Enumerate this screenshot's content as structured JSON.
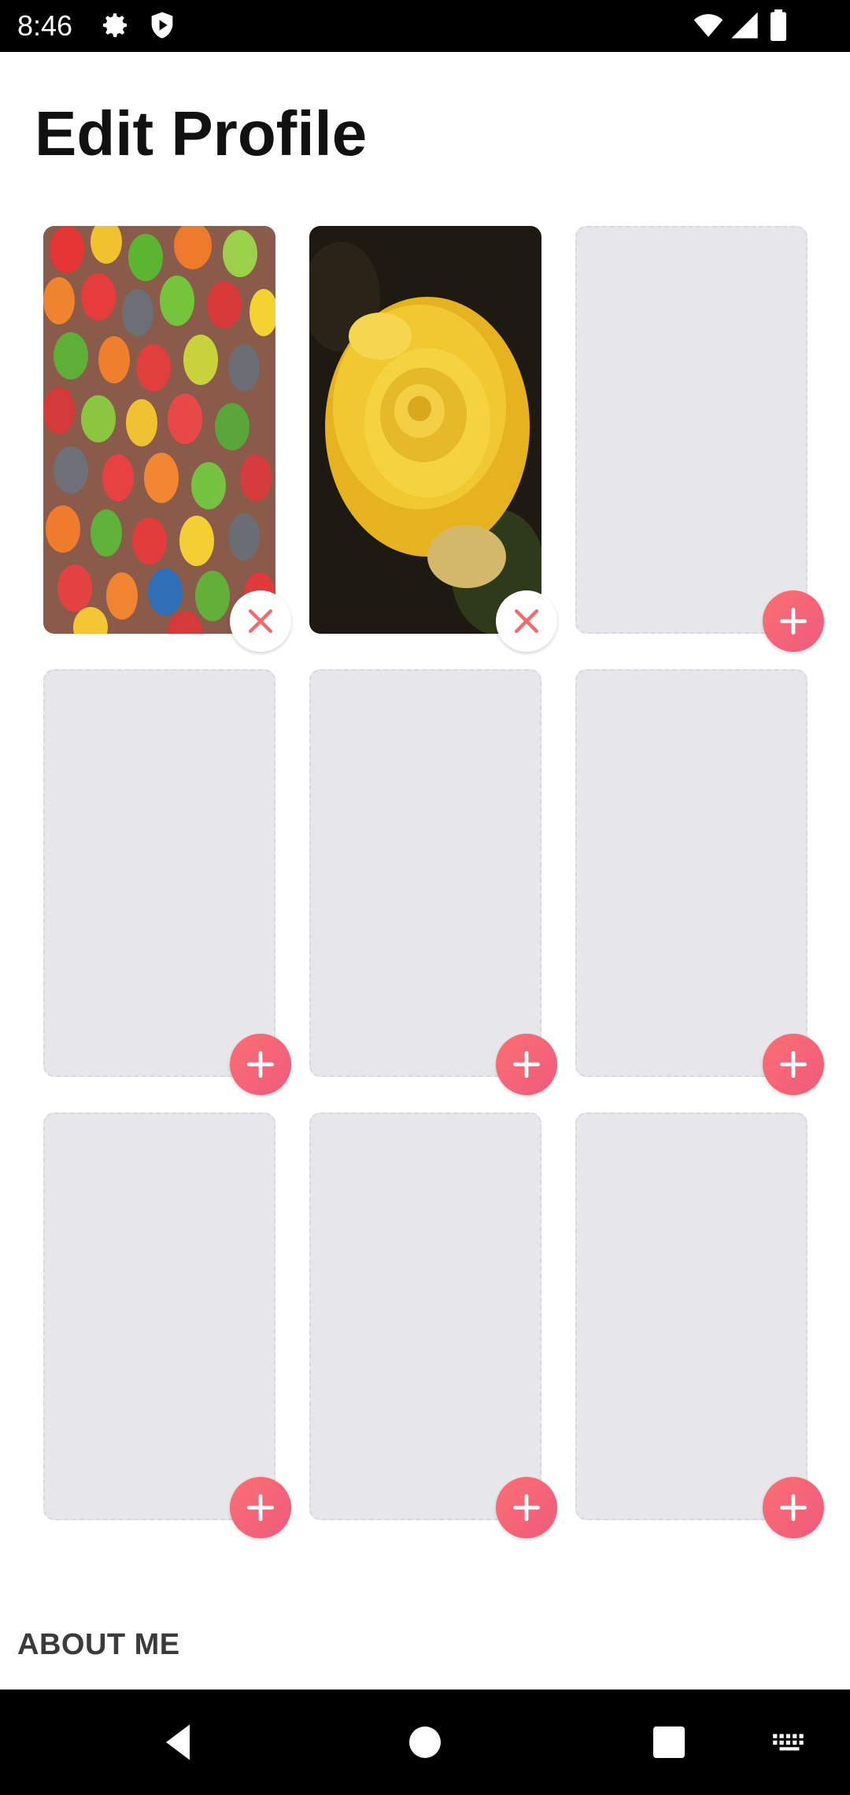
{
  "status_bar": {
    "time": "8:46",
    "icons": [
      "settings-icon",
      "shield-icon",
      "wifi-icon",
      "signal-icon",
      "battery-icon"
    ]
  },
  "page": {
    "title": "Edit Profile"
  },
  "photo_grid": {
    "slots": [
      {
        "state": "filled",
        "image": "jelly-beans-photo",
        "action": "remove"
      },
      {
        "state": "filled",
        "image": "yellow-rose-photo",
        "action": "remove"
      },
      {
        "state": "empty",
        "action": "add"
      },
      {
        "state": "empty",
        "action": "add"
      },
      {
        "state": "empty",
        "action": "add"
      },
      {
        "state": "empty",
        "action": "add"
      },
      {
        "state": "empty",
        "action": "add"
      },
      {
        "state": "empty",
        "action": "add"
      },
      {
        "state": "empty",
        "action": "add"
      }
    ]
  },
  "sections": {
    "about_me": "ABOUT ME"
  },
  "nav_bar": {
    "buttons": [
      "back-icon",
      "home-icon",
      "recents-icon",
      "keyboard-icon"
    ]
  },
  "colors": {
    "accent_start": "#fb6f74",
    "accent_end": "#ef5a7c",
    "remove_x": "#f26b6b",
    "slot_bg": "#e7e6ea"
  }
}
